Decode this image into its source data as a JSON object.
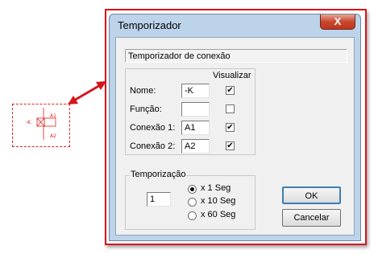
{
  "symbol": {
    "tag": "-K",
    "top_label": "A1",
    "bottom_label": "A2"
  },
  "window": {
    "title": "Temporizador",
    "close_glyph": "X"
  },
  "subtitle": "Temporizador de conexão",
  "fields": {
    "column_header": "Visualizar",
    "rows": [
      {
        "label": "Nome:",
        "value": "-K",
        "checked": true
      },
      {
        "label": "Função:",
        "value": "",
        "checked": false
      },
      {
        "label": "Conexão 1:",
        "value": "A1",
        "checked": true
      },
      {
        "label": "Conexão 2:",
        "value": "A2",
        "checked": true
      }
    ]
  },
  "timing": {
    "legend": "Temporização",
    "value": "1",
    "options": [
      {
        "label": "x 1 Seg",
        "selected": true
      },
      {
        "label": "x 10 Seg",
        "selected": false
      },
      {
        "label": "x 60 Seg",
        "selected": false
      }
    ]
  },
  "buttons": {
    "ok": "OK",
    "cancel": "Cancelar"
  },
  "colors": {
    "highlight": "#d6151b",
    "symbol": "#e02020",
    "window_frame": "#bcd3ea"
  }
}
